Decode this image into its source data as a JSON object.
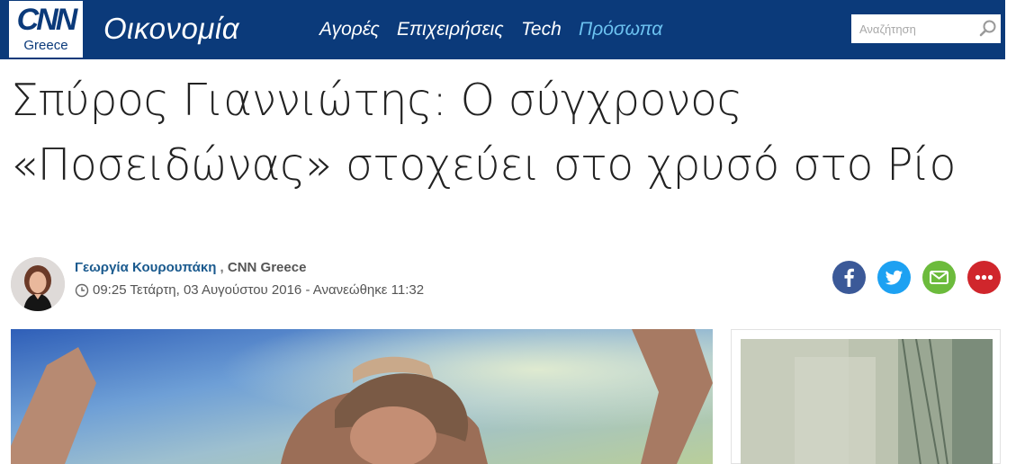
{
  "header": {
    "logo_text": "CNN",
    "logo_sub": "Greece",
    "section_title": "Οικονομία",
    "nav": [
      {
        "label": "Αγορές",
        "active": false
      },
      {
        "label": "Επιχειρήσεις",
        "active": false
      },
      {
        "label": "Tech",
        "active": false
      },
      {
        "label": "Πρόσωπα",
        "active": true
      }
    ],
    "search": {
      "placeholder": "Αναζήτηση",
      "icon": "search-icon"
    }
  },
  "colors": {
    "header_bg": "#0b3a7a",
    "active_nav": "#6cc2f0",
    "author": "#1a5a8e",
    "facebook": "#3b5998",
    "twitter": "#1da1f2",
    "email": "#6cbb3c",
    "more": "#d0262c"
  },
  "article": {
    "headline": "Σπύρος Γιαννιώτης: Ο σύγχρονος «Ποσειδώνας» στοχεύει στο χρυσό στο Ρίο",
    "author": "Γεωργία Κουρουπάκη",
    "separator": ",",
    "outlet": "CNN Greece",
    "date": "09:25 Τετάρτη, 03 Αυγούστου 2016 - Ανανεώθηκε 11:32"
  },
  "share": [
    "facebook-icon",
    "twitter-icon",
    "email-icon",
    "more-icon"
  ]
}
